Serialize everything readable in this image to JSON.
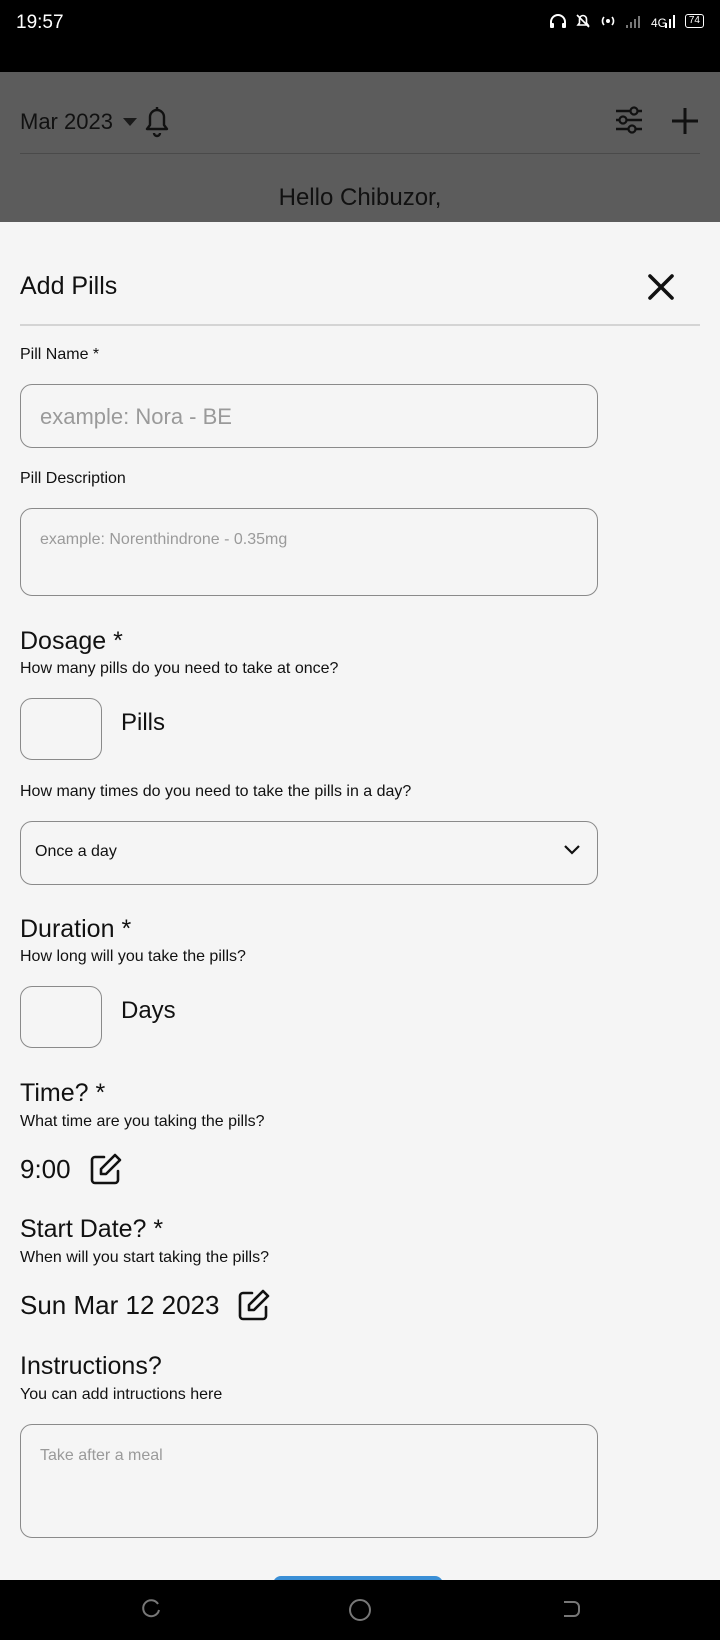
{
  "status_bar": {
    "time": "19:57",
    "battery": "74",
    "network": "4G"
  },
  "app_header": {
    "month": "Mar 2023",
    "greeting": "Hello Chibuzor,"
  },
  "sheet": {
    "title": "Add Pills",
    "pill_name": {
      "label": "Pill Name *",
      "placeholder": "example: Nora - BE"
    },
    "pill_description": {
      "label": "Pill Description",
      "placeholder": "example: Norenthindrone - 0.35mg"
    },
    "dosage": {
      "title": "Dosage *",
      "question": "How many pills do you need to take at once?",
      "unit": "Pills",
      "frequency_question": "How many times do you need to take the pills in a day?",
      "frequency_value": "Once a day"
    },
    "duration": {
      "title": "Duration *",
      "question": "How long will you take the pills?",
      "unit": "Days"
    },
    "time": {
      "title": "Time? *",
      "question": "What time are you taking the pills?",
      "value": "9:00"
    },
    "start_date": {
      "title": "Start Date? *",
      "question": "When will you start taking the pills?",
      "value": "Sun Mar 12 2023"
    },
    "instructions": {
      "title": "Instructions?",
      "question": "You can add intructions here",
      "placeholder": "Take after a meal"
    }
  },
  "icons": {
    "bell": "bell-icon",
    "filter": "sliders-icon",
    "add": "plus-icon",
    "close": "close-icon",
    "edit": "edit-icon",
    "chevron": "chevron-down-icon"
  },
  "colors": {
    "overlay": "#5c5c5c",
    "sheet": "#f5f5f5",
    "accent": "#3a8fd6"
  }
}
